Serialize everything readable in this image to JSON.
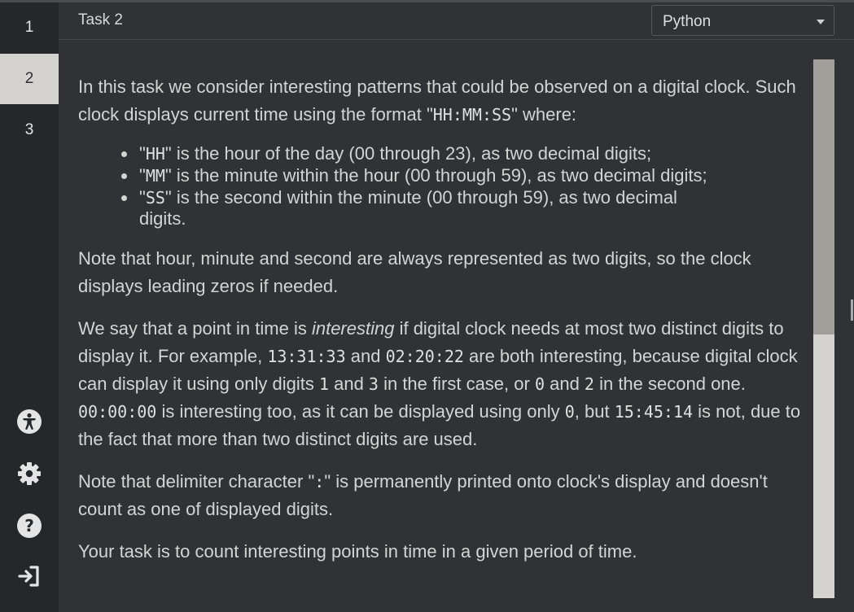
{
  "sidebar": {
    "tasks": [
      "1",
      "2",
      "3"
    ],
    "active_task": "2",
    "icons": [
      "accessibility-icon",
      "gear-icon",
      "help-icon",
      "sign-in-icon"
    ]
  },
  "header": {
    "title": "Task 2",
    "language": "Python"
  },
  "content": {
    "p1_a": "In this task we consider interesting patterns that could be observed on a digital clock. Such clock displays current time using the format \"",
    "p1_code": "HH:MM:SS",
    "p1_b": "\" where:",
    "list": [
      {
        "pre": "\"",
        "code": "HH",
        "post": "\" is the hour of the day (00 through 23), as two decimal digits;"
      },
      {
        "pre": "\"",
        "code": "MM",
        "post": "\" is the minute within the hour (00 through 59), as two decimal digits;"
      },
      {
        "pre": "\"",
        "code": "SS",
        "post": "\" is the second within the minute (00 through 59), as two decimal digits."
      }
    ],
    "p2": "Note that hour, minute and second are always represented as two digits, so the clock displays leading zeros if needed.",
    "p3_a": "We say that a point in time is ",
    "p3_em": "interesting",
    "p3_b": " if digital clock needs at most two distinct digits to display it. For example, ",
    "p3_c1": "13:31:33",
    "p3_c": " and ",
    "p3_c2": "02:20:22",
    "p3_d": " are both interesting, because digital clock can display it using only digits ",
    "p3_c3": "1",
    "p3_e": " and ",
    "p3_c4": "3",
    "p3_f": " in the first case, or ",
    "p3_c5": "0",
    "p3_g": " and ",
    "p3_c6": "2",
    "p3_h": " in the second one. ",
    "p3_c7": "00:00:00",
    "p3_i": " is interesting too, as it can be displayed using only ",
    "p3_c8": "0",
    "p3_j": ", but ",
    "p3_c9": "15:45:14",
    "p3_k": " is not, due to the fact that more than two distinct digits are used.",
    "p4_a": "Note that delimiter character \"",
    "p4_code": ":",
    "p4_b": "\" is permanently printed onto clock's display and doesn't count as one of displayed digits.",
    "p5": "Your task is to count interesting points in time in a given period of time."
  },
  "scrollbar": {
    "thumb_fraction": 0.51,
    "position_fraction": 0.0
  },
  "colors": {
    "background": "#303235",
    "sidebar": "#25272a",
    "active_tab": "#d4d3cf",
    "text": "#d4d4d4"
  }
}
